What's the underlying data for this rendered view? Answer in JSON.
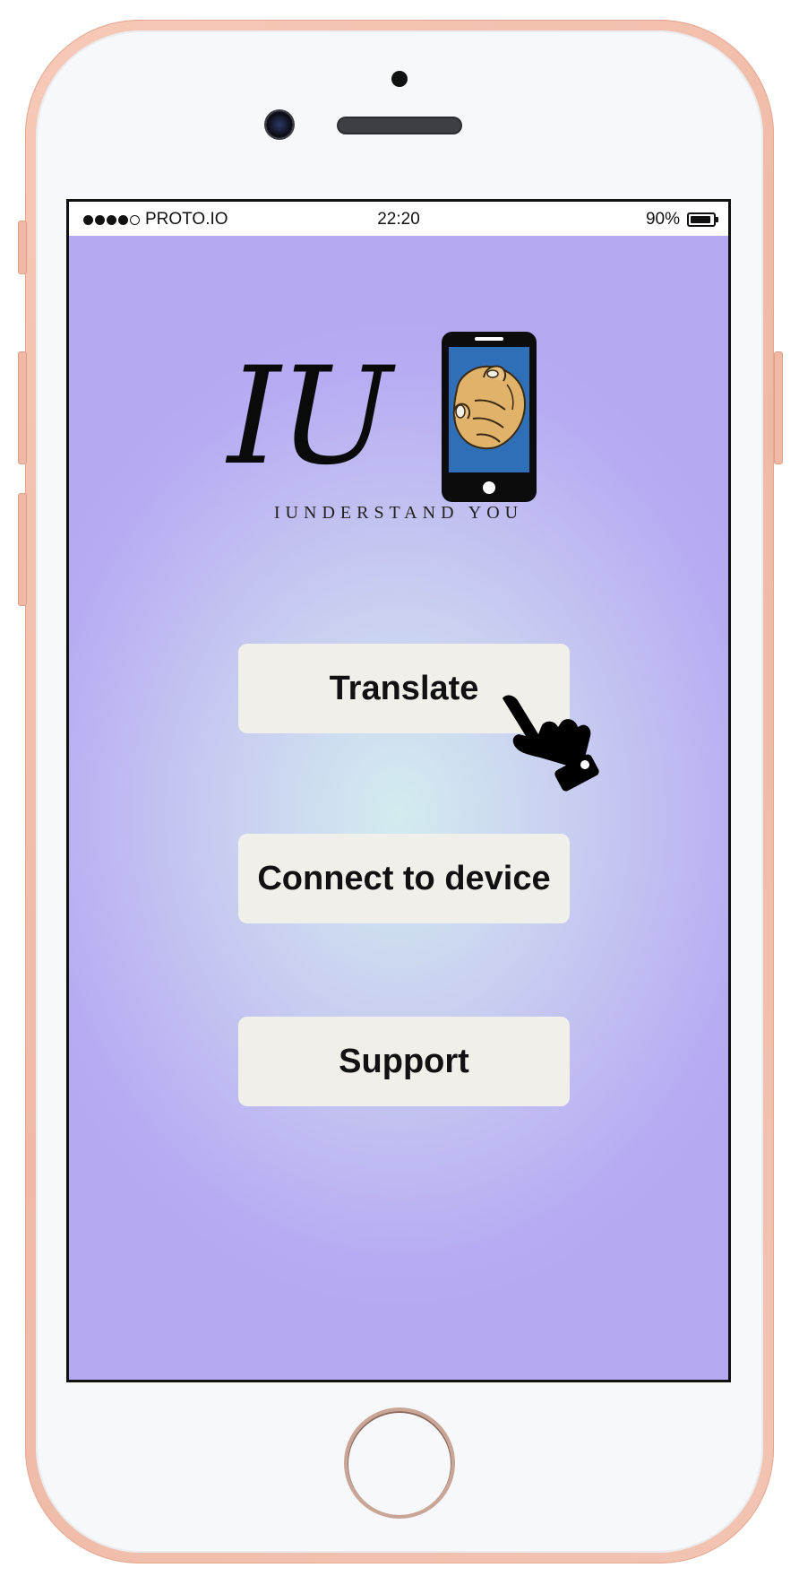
{
  "status_bar": {
    "carrier": "PROTO.IO",
    "signal_bars_filled": 4,
    "signal_bars_total": 5,
    "time": "22:20",
    "battery_percent": "90%"
  },
  "logo": {
    "mark": "IU",
    "tagline": "IUNDERSTAND YOU"
  },
  "menu": {
    "translate_label": "Translate",
    "connect_label": "Connect to device",
    "support_label": "Support"
  },
  "colors": {
    "screen_background_edge": "#b6a9f3",
    "screen_background_center": "#d3ecef",
    "button_background": "#f0efe9",
    "logo_phone_screen": "#2f6fb7",
    "logo_hand": "#e0b26a",
    "frame_rose_gold": "#f3c2b0"
  },
  "icons": {
    "pointer": "hand-pointer-icon",
    "logo_phone": "phone-pointing-hand-icon",
    "battery": "battery-icon"
  }
}
